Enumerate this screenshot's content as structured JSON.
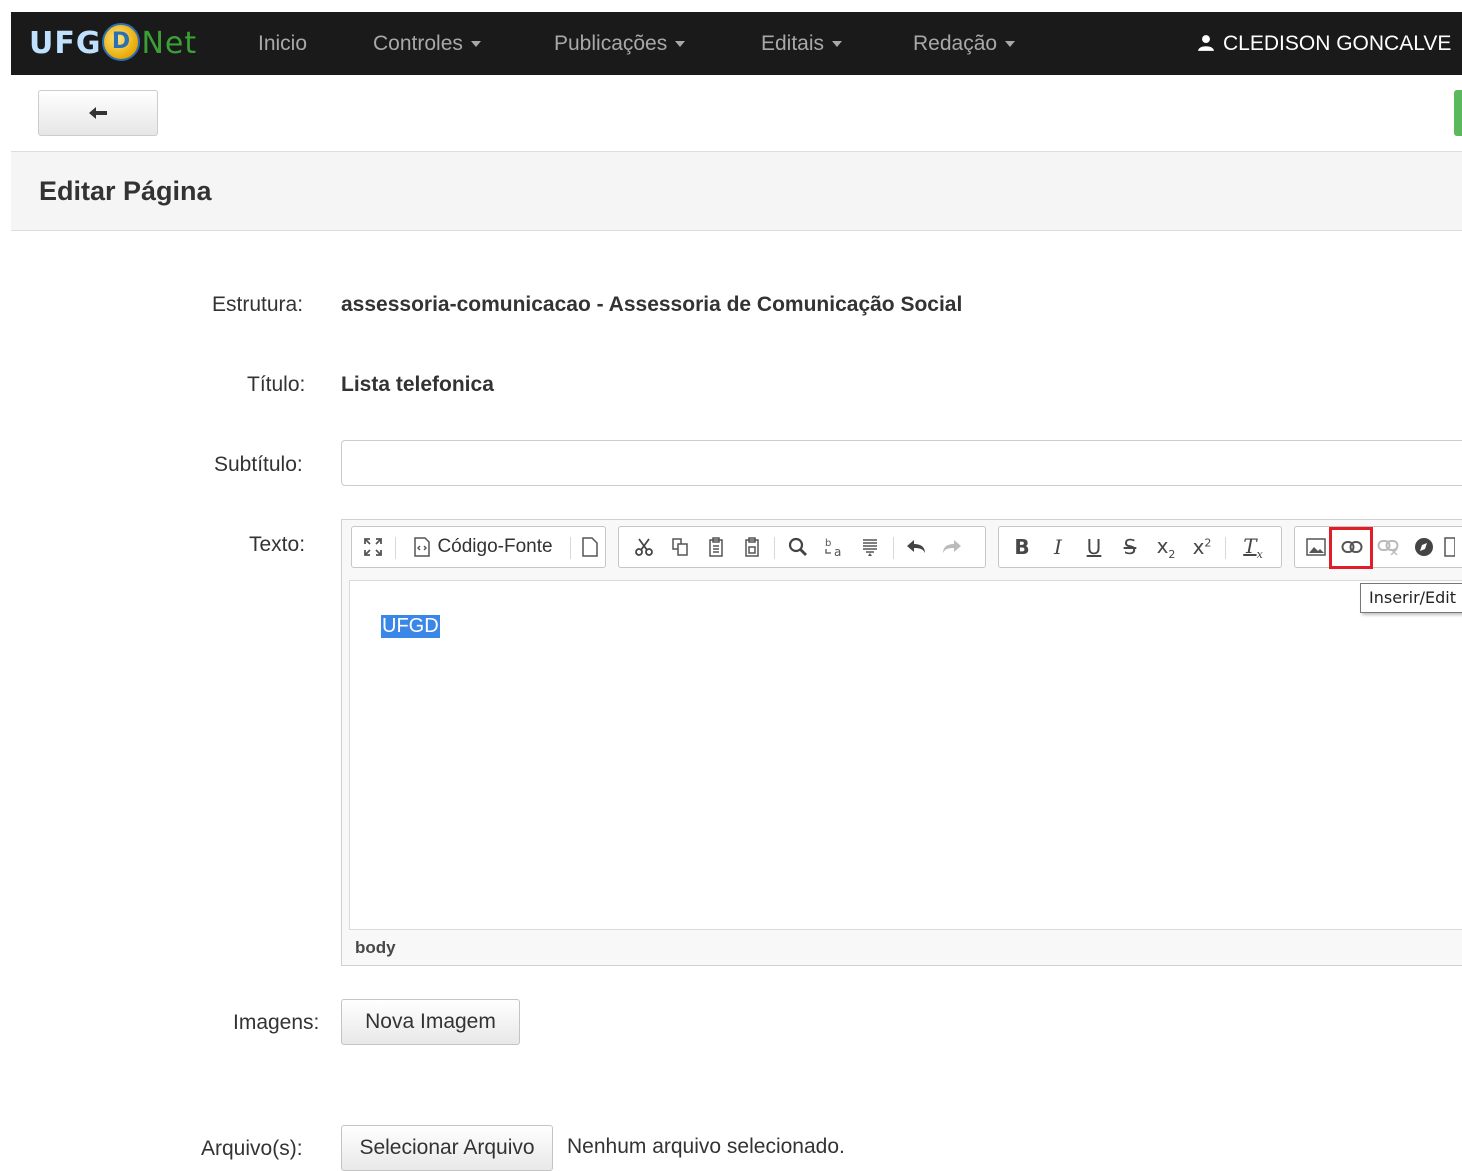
{
  "navbar": {
    "logo": {
      "part1": "UFG",
      "globe_letter": "D",
      "part2": "Net"
    },
    "items": [
      {
        "label": "Inicio",
        "dropdown": false
      },
      {
        "label": "Controles",
        "dropdown": true
      },
      {
        "label": "Publicações",
        "dropdown": true
      },
      {
        "label": "Editais",
        "dropdown": true
      },
      {
        "label": "Redação",
        "dropdown": true
      }
    ],
    "user": "CLEDISON GONCALVE"
  },
  "page": {
    "title": "Editar Página"
  },
  "form": {
    "estrutura_label": "Estrutura:",
    "estrutura_value": "assessoria-comunicacao - Assessoria de Comunicação Social",
    "titulo_label": "Título:",
    "titulo_value": "Lista telefonica",
    "subtitulo_label": "Subtítulo:",
    "subtitulo_value": "",
    "texto_label": "Texto:",
    "imagens_label": "Imagens:",
    "nova_imagem": "Nova Imagem",
    "arquivos_label": "Arquivo(s):",
    "selecionar_arquivo": "Selecionar Arquivo",
    "file_status": "Nenhum arquivo selecionado."
  },
  "editor": {
    "source_label": "Código-Fonte",
    "content_selected": "UFGD",
    "path": "body",
    "tooltip": "Inserir/Edit"
  },
  "colors": {
    "navbar": "#1a1a1a",
    "selection": "#3b87e8",
    "highlight": "#e11e28",
    "green": "#5cb85c"
  }
}
